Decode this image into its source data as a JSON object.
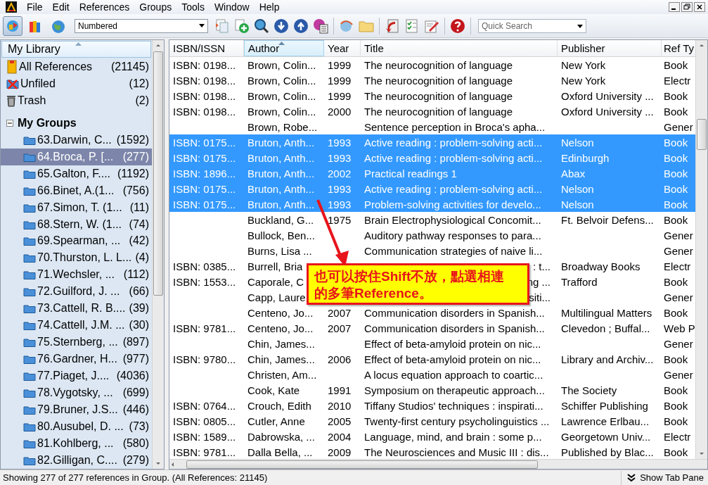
{
  "menu": [
    "File",
    "Edit",
    "References",
    "Groups",
    "Tools",
    "Window",
    "Help"
  ],
  "toolbar": {
    "mode_buttons": [
      {
        "kind": "local",
        "selected": true
      },
      {
        "kind": "online",
        "selected": false
      },
      {
        "kind": "integrated",
        "selected": false
      }
    ],
    "style": "Numbered",
    "quick_search_placeholder": "Quick Search"
  },
  "sidebar": {
    "header": "My Library",
    "library": [
      {
        "kind": "all",
        "label": "All References",
        "count": "(21145)"
      },
      {
        "kind": "unfiled",
        "label": "Unfiled",
        "count": "(12)"
      },
      {
        "kind": "trash",
        "label": "Trash",
        "count": "(2)"
      }
    ],
    "groups_header": {
      "label": "My Groups",
      "expanded": true
    },
    "groups": [
      {
        "label": "63.Darwin, C...",
        "count": "(1592)",
        "selected": false
      },
      {
        "label": "64.Broca, P. [...",
        "count": "(277)",
        "selected": true
      },
      {
        "label": "65.Galton, F....",
        "count": "(1192)",
        "selected": false
      },
      {
        "label": "66.Binet, A.(1...",
        "count": "(756)",
        "selected": false
      },
      {
        "label": "67.Simon, T. (1...",
        "count": "(11)",
        "selected": false
      },
      {
        "label": "68.Stern, W. (1...",
        "count": "(74)",
        "selected": false
      },
      {
        "label": "69.Spearman, ...",
        "count": "(42)",
        "selected": false
      },
      {
        "label": "70.Thurston, L. L...",
        "count": "(4)",
        "selected": false
      },
      {
        "label": "71.Wechsler, ...",
        "count": "(112)",
        "selected": false
      },
      {
        "label": "72.Guilford, J. ...",
        "count": "(66)",
        "selected": false
      },
      {
        "label": "73.Cattell, R. B....",
        "count": "(39)",
        "selected": false
      },
      {
        "label": "74.Cattell, J.M. ...",
        "count": "(30)",
        "selected": false
      },
      {
        "label": "75.Sternberg, ...",
        "count": "(897)",
        "selected": false
      },
      {
        "label": "76.Gardner, H...",
        "count": "(977)",
        "selected": false
      },
      {
        "label": "77.Piaget, J....",
        "count": "(4036)",
        "selected": false
      },
      {
        "label": "78.Vygotsky, ...",
        "count": "(699)",
        "selected": false
      },
      {
        "label": "79.Bruner, J.S...",
        "count": "(446)",
        "selected": false
      },
      {
        "label": "80.Ausubel, D. ...",
        "count": "(73)",
        "selected": false
      },
      {
        "label": "81.Kohlberg, ...",
        "count": "(580)",
        "selected": false
      },
      {
        "label": "82.Gilligan, C....",
        "count": "(279)",
        "selected": false
      }
    ]
  },
  "table": {
    "columns": [
      {
        "label": "ISBN/ISSN",
        "sorted": false
      },
      {
        "label": "Author",
        "sorted": true
      },
      {
        "label": "Year",
        "sorted": false
      },
      {
        "label": "Title",
        "sorted": false
      },
      {
        "label": "Publisher",
        "sorted": false
      },
      {
        "label": "Ref Ty",
        "sorted": false
      }
    ],
    "rows": [
      {
        "isbn": "ISBN: 0198...",
        "author": "Brown, Colin...",
        "year": "1999",
        "title": "The neurocognition of language",
        "publisher": "New York",
        "ref_type": "Book",
        "selected": false
      },
      {
        "isbn": "ISBN: 0198...",
        "author": "Brown, Colin...",
        "year": "1999",
        "title": "The neurocognition of language",
        "publisher": "New York",
        "ref_type": "Electr",
        "selected": false
      },
      {
        "isbn": "ISBN: 0198...",
        "author": "Brown, Colin...",
        "year": "1999",
        "title": "The neurocognition of language",
        "publisher": "Oxford University ...",
        "ref_type": "Book",
        "selected": false
      },
      {
        "isbn": "ISBN: 0198...",
        "author": "Brown, Colin...",
        "year": "2000",
        "title": "The neurocognition of language",
        "publisher": "Oxford University ...",
        "ref_type": "Book",
        "selected": false
      },
      {
        "author": "Brown, Robe...",
        "title": "Sentence perception in Broca's apha...",
        "ref_type": "Gener",
        "selected": false
      },
      {
        "isbn": "ISBN: 0175...",
        "author": "Bruton, Anth...",
        "year": "1993",
        "title": "Active reading : problem-solving acti...",
        "publisher": "Nelson",
        "ref_type": "Book",
        "selected": true
      },
      {
        "isbn": "ISBN: 0175...",
        "author": "Bruton, Anth...",
        "year": "1993",
        "title": "Active reading : problem-solving acti...",
        "publisher": "Edinburgh",
        "ref_type": "Book",
        "selected": true
      },
      {
        "isbn": "ISBN: 1896...",
        "author": "Bruton, Anth...",
        "year": "2002",
        "title": "Practical readings 1",
        "publisher": "Abax",
        "ref_type": "Book",
        "selected": true
      },
      {
        "isbn": "ISBN: 0175...",
        "author": "Bruton, Anth...",
        "year": "1993",
        "title": "Active reading : problem-solving acti...",
        "publisher": "Nelson",
        "ref_type": "Book",
        "selected": true
      },
      {
        "isbn": "ISBN: 0175...",
        "author": "Bruton, Anth...",
        "year": "1993",
        "title": "Problem-solving activities for develo...",
        "publisher": "Nelson",
        "ref_type": "Book",
        "selected": true
      },
      {
        "author": "Buckland, G...",
        "year": "1975",
        "title": "Brain Electrophysiological Concomit...",
        "publisher": "Ft. Belvoir Defens...",
        "ref_type": "Book",
        "selected": false
      },
      {
        "author": "Bullock, Ben...",
        "title": "Auditory pathway responses to para...",
        "ref_type": "Gener",
        "selected": false
      },
      {
        "author": "Burns, Lisa ...",
        "title": "Communication strategies of naive li...",
        "ref_type": "Gener",
        "selected": false
      },
      {
        "isbn": "ISBN: 0385...",
        "author": "Burrell, Bria",
        "title_tail": ": t...",
        "publisher": "Broadway Books",
        "ref_type": "Electr",
        "selected": false
      },
      {
        "isbn": "ISBN: 1553...",
        "author": "Caporale, C",
        "title_tail": "ng ...",
        "publisher": "Trafford",
        "ref_type": "Book",
        "selected": false
      },
      {
        "author": "Capp, Laure",
        "title_tail": "siti...",
        "ref_type": "Gener",
        "selected": false
      },
      {
        "author": "Centeno, Jo...",
        "year": "2007",
        "title": "Communication disorders in Spanish...",
        "publisher": "Multilingual Matters",
        "ref_type": "Book",
        "selected": false
      },
      {
        "isbn": "ISBN: 9781...",
        "author": "Centeno, Jo...",
        "year": "2007",
        "title": "Communication disorders in Spanish...",
        "publisher": "Clevedon ; Buffal...",
        "ref_type": "Web P",
        "selected": false
      },
      {
        "author": "Chin, James...",
        "title": "Effect of beta-amyloid protein on nic...",
        "ref_type": "Gener",
        "selected": false
      },
      {
        "isbn": "ISBN: 9780...",
        "author": "Chin, James...",
        "year": "2006",
        "title": "Effect of beta-amyloid protein on nic...",
        "publisher": "Library and Archiv...",
        "ref_type": "Book",
        "selected": false
      },
      {
        "author": "Christen, Am...",
        "title": "A locus equation approach to coartic...",
        "ref_type": "Gener",
        "selected": false
      },
      {
        "author": "Cook, Kate",
        "year": "1991",
        "title": "Symposium on therapeutic approach...",
        "publisher": "The Society",
        "ref_type": "Book",
        "selected": false
      },
      {
        "isbn": "ISBN: 0764...",
        "author": "Crouch, Edith",
        "year": "2010",
        "title": "Tiffany Studios' techniques : inspirati...",
        "publisher": "Schiffer Publishing",
        "ref_type": "Book",
        "selected": false
      },
      {
        "isbn": "ISBN: 0805...",
        "author": "Cutler, Anne",
        "year": "2005",
        "title": "Twenty-first century psycholinguistics ...",
        "publisher": "Lawrence Erlbau...",
        "ref_type": "Book",
        "selected": false
      },
      {
        "isbn": "ISBN: 1589...",
        "author": "Dabrowska, ...",
        "year": "2004",
        "title": "Language, mind, and brain : some p...",
        "publisher": "Georgetown Univ...",
        "ref_type": "Electr",
        "selected": false
      },
      {
        "isbn": "ISBN: 9781...",
        "author": "Dalla Bella, ...",
        "year": "2009",
        "title": "The Neurosciences and Music III : dis...",
        "publisher": "Published by Blac...",
        "ref_type": "Book",
        "selected": false
      }
    ]
  },
  "callout": "也可以按住Shift不放，點選相連的多筆Reference。",
  "status_bar": {
    "message": "Showing 277 of 277 references in Group. (All References: 21145)",
    "tab_pane_button": "Show Tab Pane"
  }
}
